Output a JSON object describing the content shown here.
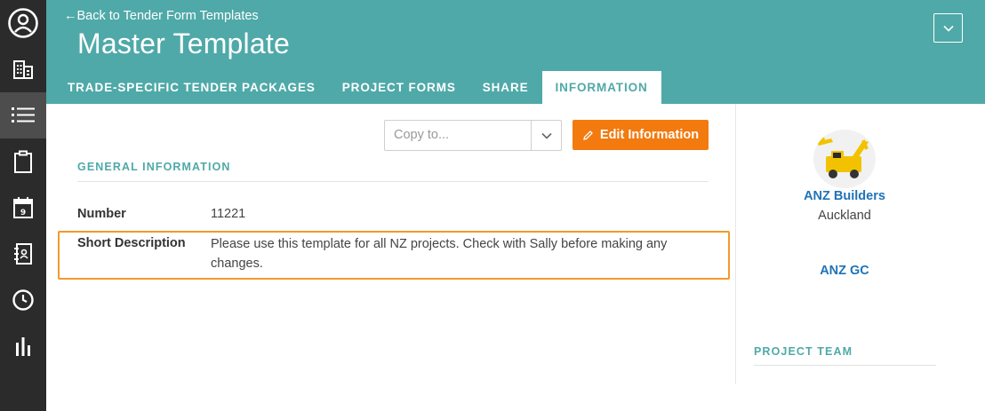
{
  "nav": {
    "back_link": "←Back to Tender Form Templates",
    "title": "Master Template",
    "tabs": [
      {
        "label": "TRADE-SPECIFIC TENDER PACKAGES",
        "active": false
      },
      {
        "label": "PROJECT FORMS",
        "active": false
      },
      {
        "label": "SHARE",
        "active": false
      },
      {
        "label": "INFORMATION",
        "active": true
      }
    ]
  },
  "sidebar": {
    "icons": [
      "user-icon",
      "buildings-icon",
      "list-icon",
      "clipboard-icon",
      "calendar-icon",
      "contacts-book-icon",
      "clock-icon",
      "bar-chart-icon"
    ],
    "active_index": 2
  },
  "toolbar": {
    "copy_placeholder": "Copy to...",
    "edit_label": "Edit Information"
  },
  "general": {
    "title": "GENERAL INFORMATION",
    "fields": [
      {
        "label": "Number",
        "value": "11221"
      },
      {
        "label": "Short Description",
        "value_lines": [
          "Please use this template for all NZ projects. Check with Sally before making any",
          "changes."
        ]
      }
    ]
  },
  "company": {
    "name": "ANZ Builders",
    "city": "Auckland",
    "gc": "ANZ GC"
  },
  "team": {
    "title": "PROJECT TEAM"
  },
  "colors": {
    "header": "#4fa9a8",
    "accent_orange": "#f27a0f",
    "highlight": "#f29a2e",
    "link_blue": "#1f73b7",
    "rail": "#2b2b2b"
  }
}
